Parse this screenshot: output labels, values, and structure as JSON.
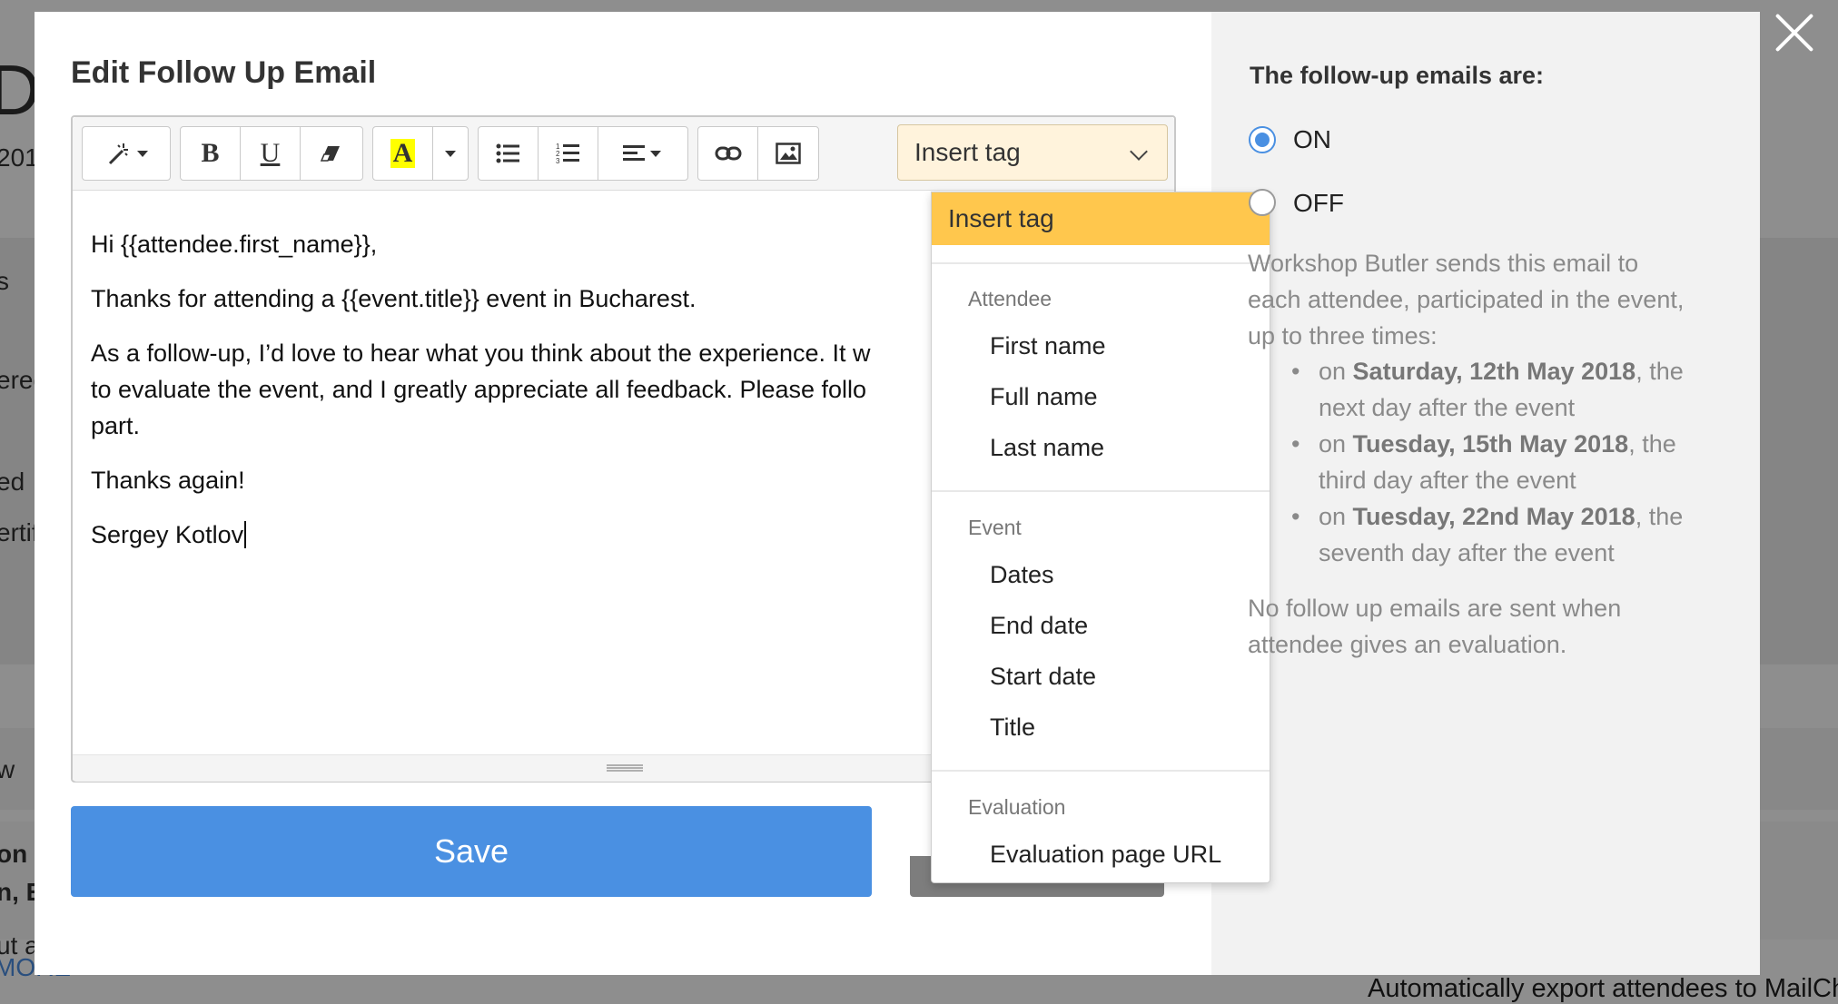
{
  "background_page": {
    "fragments": [
      "Da",
      "201",
      "s",
      "ered",
      "ed",
      "ertif",
      "w",
      "on",
      "n, E",
      "ut a",
      "MORE"
    ],
    "bottom_text": "Automatically export attendees to MailCh"
  },
  "modal": {
    "title": "Edit Follow Up Email",
    "editor": {
      "toolbar": {
        "insert_tag_label": "Insert tag",
        "buttons": [
          "magic-wand",
          "bold",
          "underline",
          "eraser",
          "highlight",
          "more",
          "bullet-list",
          "numbered-list",
          "align",
          "link",
          "image"
        ],
        "bold_glyph": "B",
        "underline_glyph": "U",
        "highlight_glyph": "A"
      },
      "body": {
        "greeting": "Hi {{attendee.first_name}},",
        "line1": "Thanks for attending a {{event.title}} event in Bucharest.",
        "para2_line1": "As a follow-up, I’d love to hear what you think about the experience. It w",
        "para2_line2": "to evaluate the event, and I greatly appreciate all feedback. Please follo",
        "para2_line3": "part.",
        "thanks": "Thanks again!",
        "signature": "Sergey Kotlov"
      }
    },
    "save_label": "Save",
    "dropdown": {
      "active": "Insert tag",
      "groups": [
        {
          "header": "Attendee",
          "items": [
            "First name",
            "Full name",
            "Last name"
          ]
        },
        {
          "header": "Event",
          "items": [
            "Dates",
            "End date",
            "Start date",
            "Title"
          ]
        },
        {
          "header": "Evaluation",
          "items": [
            "Evaluation page URL"
          ]
        }
      ]
    },
    "side": {
      "title": "The follow-up emails are:",
      "on_label": "ON",
      "off_label": "OFF",
      "selected": "ON",
      "description_l1": "Workshop Butler sends this email to",
      "description_l2": "each attendee, participated in the event,",
      "description_l3": "up to three times:",
      "schedule": [
        {
          "prefix": "on ",
          "date": "Saturday, 12th May 2018",
          "suffix": ", the",
          "note": "next day after the event"
        },
        {
          "prefix": "on ",
          "date": "Tuesday, 15th May 2018",
          "suffix": ", the",
          "note": "third day after the event"
        },
        {
          "prefix": "on ",
          "date": "Tuesday, 22nd May 2018",
          "suffix": ", the",
          "note": "seventh day after the event"
        }
      ],
      "footer_l1": "No follow up emails are sent when",
      "footer_l2": "attendee gives an evaluation."
    }
  },
  "colors": {
    "accent_blue": "#4a90e2",
    "tag_highlight": "#ffc74d",
    "insert_tag_bg": "#fff3dc",
    "overlay": "#8e8e8e"
  }
}
